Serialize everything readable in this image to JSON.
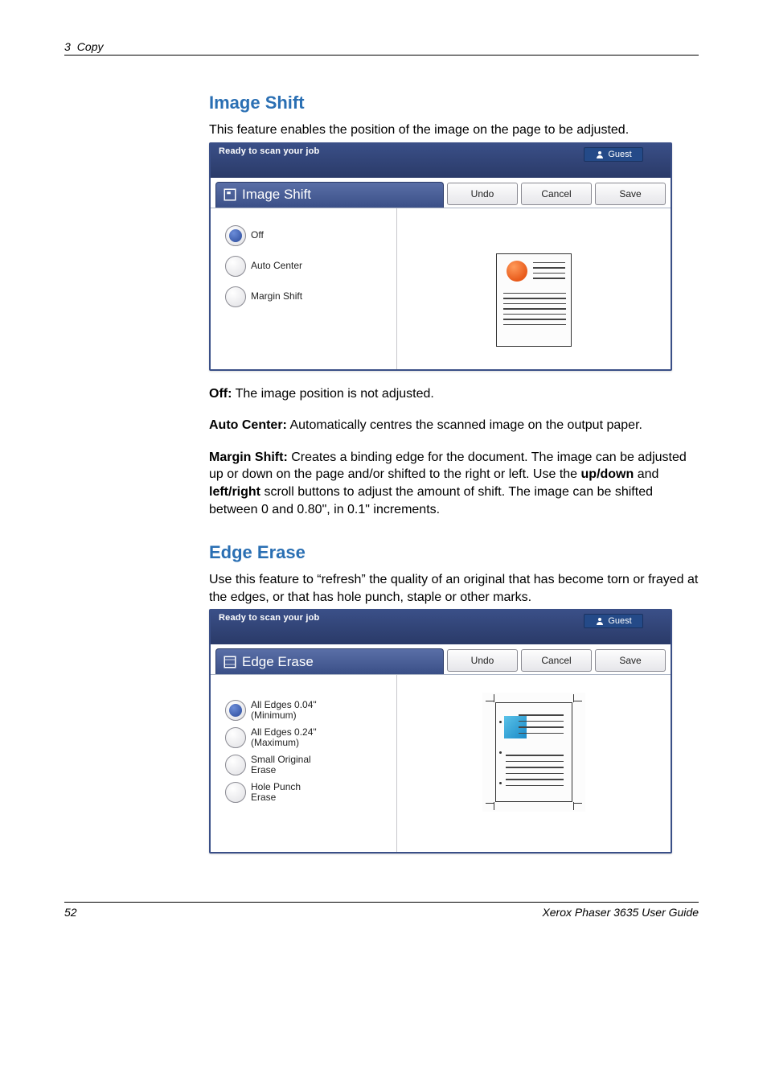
{
  "header": {
    "chapter_num": "3",
    "chapter_title": "Copy"
  },
  "section1": {
    "title": "Image Shift",
    "intro": "This feature enables the position of the image on the page to be adjusted.",
    "panel": {
      "status": "Ready to scan your job",
      "guest": "Guest",
      "tab_title": "Image Shift",
      "undo": "Undo",
      "cancel": "Cancel",
      "save": "Save",
      "options": [
        {
          "label": "Off",
          "selected": true
        },
        {
          "label": "Auto Center",
          "selected": false
        },
        {
          "label": "Margin Shift",
          "selected": false
        }
      ]
    },
    "notes": [
      {
        "term": "Off:",
        "text": " The image position is not adjusted."
      },
      {
        "term": "Auto Center:",
        "text": " Automatically centres the scanned image on the output paper."
      },
      {
        "term": "Margin Shift:",
        "text": " Creates a binding edge for the document. The image can be adjusted up or down on the page and/or shifted to the right or left. Use the "
      },
      {
        "term2": "up/down",
        "mid": " and ",
        "term3": "left/right",
        "text2": " scroll buttons to adjust the amount of shift. The image can be shifted between 0 and 0.80\", in 0.1\" increments."
      }
    ]
  },
  "section2": {
    "title": "Edge Erase",
    "intro": "Use this feature to “refresh” the quality of an original that has become torn or frayed at the edges, or that has hole punch, staple or other marks.",
    "panel": {
      "status": "Ready to scan your job",
      "guest": "Guest",
      "tab_title": "Edge Erase",
      "undo": "Undo",
      "cancel": "Cancel",
      "save": "Save",
      "options": [
        {
          "label": "All Edges 0.04\"\n(Minimum)",
          "selected": true
        },
        {
          "label": "All Edges 0.24\"\n(Maximum)",
          "selected": false
        },
        {
          "label": "Small Original\nErase",
          "selected": false
        },
        {
          "label": "Hole Punch\nErase",
          "selected": false
        }
      ]
    }
  },
  "footer": {
    "page_num": "52",
    "guide": "Xerox Phaser 3635 User Guide"
  }
}
